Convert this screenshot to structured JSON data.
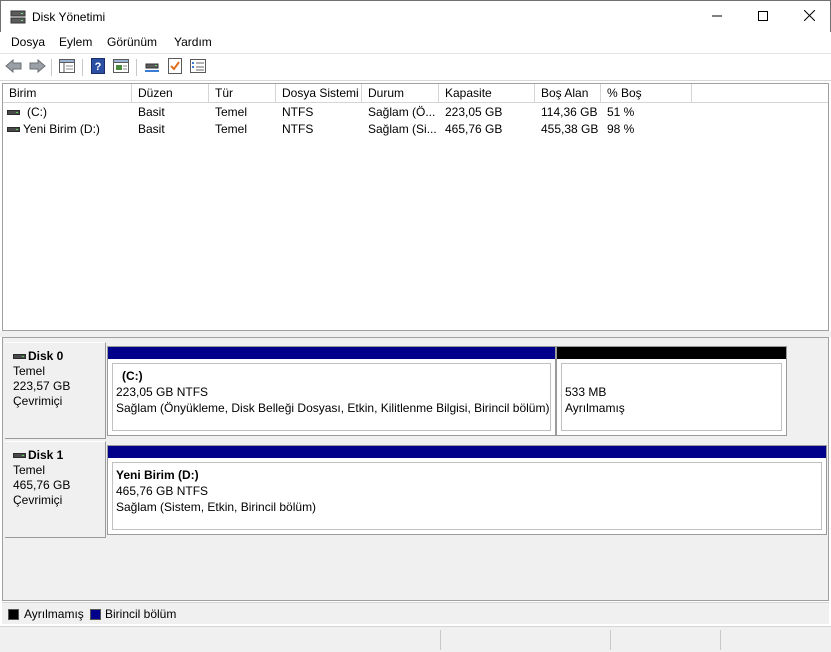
{
  "window": {
    "title": "Disk Yönetimi",
    "minimize_icon": "minimize-icon",
    "maximize_icon": "maximize-icon",
    "close_icon": "close-icon"
  },
  "menu": {
    "items": [
      {
        "label": "Dosya"
      },
      {
        "label": "Eylem"
      },
      {
        "label": "Görünüm"
      },
      {
        "label": "Yardım"
      }
    ]
  },
  "toolbar": {
    "buttons": [
      "back-icon",
      "forward-icon",
      "console-tree-icon",
      "help-icon",
      "properties-icon",
      "disk-connect-icon",
      "checklist-icon",
      "list-view-icon"
    ]
  },
  "volume_list": {
    "columns": [
      "Birim",
      "Düzen",
      "Tür",
      "Dosya Sistemi",
      "Durum",
      "Kapasite",
      "Boş Alan",
      "% Boş"
    ],
    "rows": [
      {
        "birim": "(C:)",
        "duzen": "Basit",
        "tur": "Temel",
        "dosya_sistemi": "NTFS",
        "durum": "Sağlam (Ö...",
        "kapasite": "223,05 GB",
        "bos_alan": "114,36 GB",
        "yuzde_bos": "51 %"
      },
      {
        "birim": "Yeni Birim (D:)",
        "duzen": "Basit",
        "tur": "Temel",
        "dosya_sistemi": "NTFS",
        "durum": "Sağlam (Si...",
        "kapasite": "465,76 GB",
        "bos_alan": "455,38 GB",
        "yuzde_bos": "98 %"
      }
    ]
  },
  "disks": [
    {
      "name": "Disk 0",
      "type": "Temel",
      "size": "223,57 GB",
      "status": "Çevrimiçi",
      "partitions": [
        {
          "name": "(C:)",
          "size_fs": "223,05 GB NTFS",
          "status": "Sağlam (Önyükleme, Disk Belleği Dosyası, Etkin, Kilitlenme Bilgisi, Birincil bölüm)",
          "bar_color": "#00008b"
        },
        {
          "name": "",
          "size_fs": "533 MB",
          "status": "Ayrılmamış",
          "bar_color": "#000000"
        }
      ]
    },
    {
      "name": "Disk 1",
      "type": "Temel",
      "size": "465,76 GB",
      "status": "Çevrimiçi",
      "partitions": [
        {
          "name": "Yeni Birim  (D:)",
          "size_fs": "465,76 GB NTFS",
          "status": "Sağlam (Sistem, Etkin, Birincil bölüm)",
          "bar_color": "#00008b"
        }
      ]
    }
  ],
  "legend": [
    {
      "label": "Ayrılmamış",
      "color": "#000000"
    },
    {
      "label": "Birincil bölüm",
      "color": "#00008b"
    }
  ],
  "colors": {
    "primary_partition": "#00008b",
    "unallocated": "#000000"
  }
}
